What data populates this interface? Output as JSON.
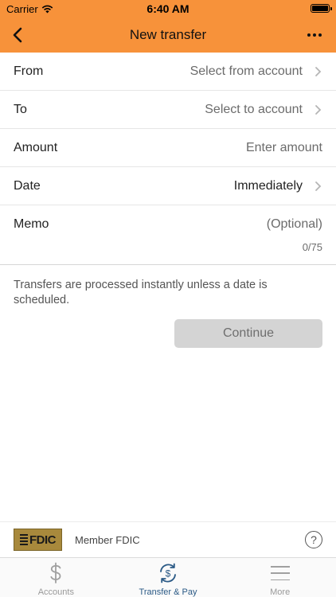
{
  "status_bar": {
    "carrier": "Carrier",
    "time": "6:40 AM"
  },
  "nav": {
    "title": "New transfer",
    "back_icon": "chevron-left-icon",
    "more_icon": "ellipsis-icon",
    "bar_color": "#f7923a"
  },
  "form": {
    "from": {
      "label": "From",
      "value": "Select from account"
    },
    "to": {
      "label": "To",
      "value": "Select to account"
    },
    "amount": {
      "label": "Amount",
      "placeholder": "Enter amount"
    },
    "date": {
      "label": "Date",
      "value": "Immediately"
    },
    "memo": {
      "label": "Memo",
      "placeholder": "(Optional)",
      "counter": "0/75"
    }
  },
  "info_text": "Transfers are processed instantly unless a date is scheduled.",
  "continue_label": "Continue",
  "footer": {
    "fdic_logo_text": "FDIC",
    "member_text": "Member FDIC",
    "help_icon": "question-circle-icon"
  },
  "tabs": [
    {
      "label": "Accounts",
      "icon": "dollar-icon",
      "active": false
    },
    {
      "label": "Transfer & Pay",
      "icon": "transfer-dollar-icon",
      "active": true
    },
    {
      "label": "More",
      "icon": "menu-icon",
      "active": false
    }
  ]
}
